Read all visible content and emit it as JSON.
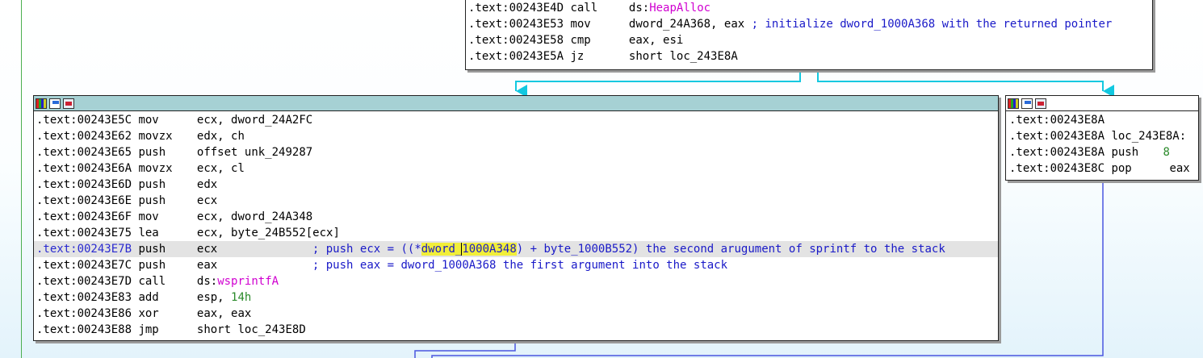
{
  "top_node": {
    "lines": [
      {
        "addr": ".text:00243E4D",
        "mnem": "call",
        "op_pre": "ds:",
        "op_import": "HeapAlloc",
        "op_post": "",
        "comment": ""
      },
      {
        "addr": ".text:00243E53",
        "mnem": "mov",
        "op": "dword_24A368, eax",
        "comment": "; initialize dword_1000A368 with the returned pointer"
      },
      {
        "addr": ".text:00243E58",
        "mnem": "cmp",
        "op": "eax, esi",
        "comment": ""
      },
      {
        "addr": ".text:00243E5A",
        "mnem": "jz",
        "op": "short loc_243E8A",
        "comment": ""
      }
    ]
  },
  "main_node": {
    "lines": [
      {
        "addr": ".text:00243E5C",
        "mnem": "mov",
        "op": "ecx, dword_24A2FC",
        "comment": ""
      },
      {
        "addr": ".text:00243E62",
        "mnem": "movzx",
        "op": "edx, ch",
        "comment": ""
      },
      {
        "addr": ".text:00243E65",
        "mnem": "push",
        "op": "offset unk_249287",
        "comment": ""
      },
      {
        "addr": ".text:00243E6A",
        "mnem": "movzx",
        "op": "ecx, cl",
        "comment": ""
      },
      {
        "addr": ".text:00243E6D",
        "mnem": "push",
        "op": "edx",
        "comment": ""
      },
      {
        "addr": ".text:00243E6E",
        "mnem": "push",
        "op": "ecx",
        "comment": ""
      },
      {
        "addr": ".text:00243E6F",
        "mnem": "mov",
        "op": "ecx, dword_24A348",
        "comment": ""
      },
      {
        "addr": ".text:00243E75",
        "mnem": "lea",
        "op": "ecx, byte_24B552[ecx]",
        "comment": ""
      },
      {
        "addr": ".text:00243E7B",
        "mnem": "push",
        "op": "ecx",
        "comment_pre": "; push ecx = ((*",
        "comment_hl1": "dword_",
        "comment_hl2": "1000A348",
        "comment_post": ") + byte_1000B552) the second arugument of sprintf to the stack"
      },
      {
        "addr": ".text:00243E7C",
        "mnem": "push",
        "op": "eax",
        "comment": "; push eax = dword_1000A368 the first argument into the stack"
      },
      {
        "addr": ".text:00243E7D",
        "mnem": "call",
        "op_pre": "ds:",
        "op_import": "wsprintfA"
      },
      {
        "addr": ".text:00243E83",
        "mnem": "add",
        "op_pre": "esp, ",
        "op_num": "14h"
      },
      {
        "addr": ".text:00243E86",
        "mnem": "xor",
        "op": "eax, eax",
        "comment": ""
      },
      {
        "addr": ".text:00243E88",
        "mnem": "jmp",
        "op": "short loc_243E8D",
        "comment": ""
      }
    ]
  },
  "right_node": {
    "lines": [
      {
        "addr": ".text:00243E8A",
        "text": ""
      },
      {
        "addr": ".text:00243E8A",
        "text": "loc_243E8A:"
      },
      {
        "addr": ".text:00243E8A",
        "mnem": "push",
        "op_num": "8"
      },
      {
        "addr": ".text:00243E8C",
        "mnem": "pop",
        "op": "eax"
      }
    ]
  }
}
